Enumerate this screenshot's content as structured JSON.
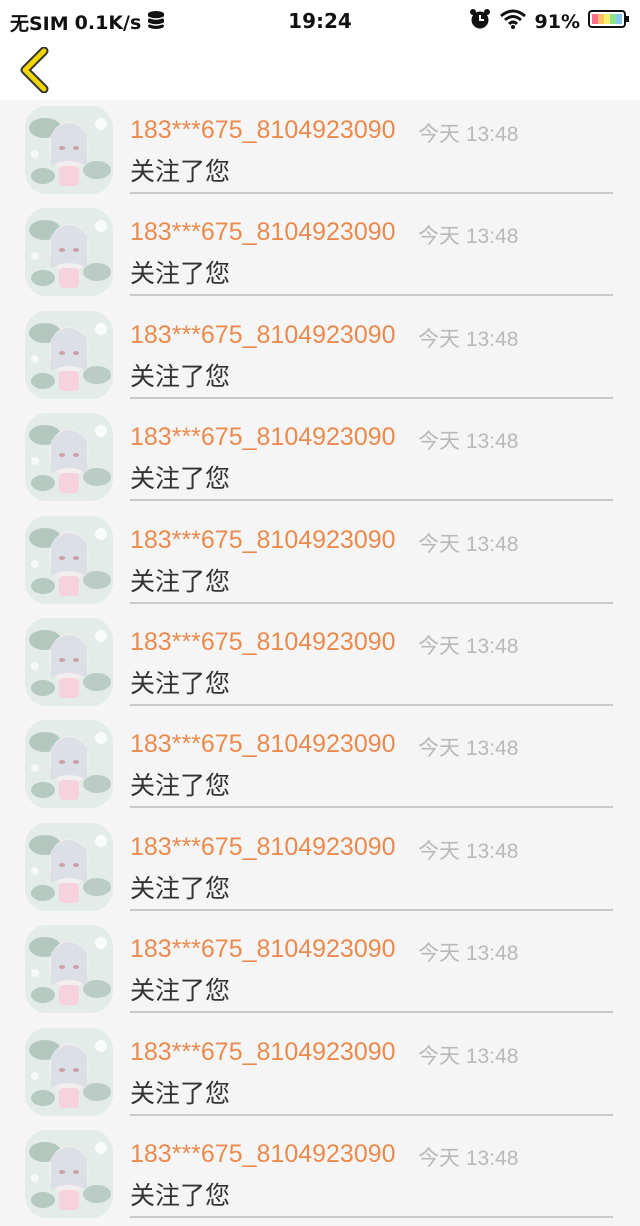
{
  "status_bar": {
    "carrier": "无SIM",
    "net_speed": "0.1K/s",
    "time": "19:24",
    "battery": "91%"
  },
  "nav": {
    "back_icon": "chevron-left-icon",
    "accent_color": "#f2d400"
  },
  "notifications": [
    {
      "user": "183***675_8104923090",
      "time": "今天 13:48",
      "message": "关注了您"
    },
    {
      "user": "183***675_8104923090",
      "time": "今天 13:48",
      "message": "关注了您"
    },
    {
      "user": "183***675_8104923090",
      "time": "今天 13:48",
      "message": "关注了您"
    },
    {
      "user": "183***675_8104923090",
      "time": "今天 13:48",
      "message": "关注了您"
    },
    {
      "user": "183***675_8104923090",
      "time": "今天 13:48",
      "message": "关注了您"
    },
    {
      "user": "183***675_8104923090",
      "time": "今天 13:48",
      "message": "关注了您"
    },
    {
      "user": "183***675_8104923090",
      "time": "今天 13:48",
      "message": "关注了您"
    },
    {
      "user": "183***675_8104923090",
      "time": "今天 13:48",
      "message": "关注了您"
    },
    {
      "user": "183***675_8104923090",
      "time": "今天 13:48",
      "message": "关注了您"
    },
    {
      "user": "183***675_8104923090",
      "time": "今天 13:48",
      "message": "关注了您"
    },
    {
      "user": "183***675_8104923090",
      "time": "今天 13:48",
      "message": "关注了您"
    }
  ],
  "colors": {
    "username": "#ec8a4e",
    "timestamp": "#b9b9b9",
    "message": "#333333"
  }
}
